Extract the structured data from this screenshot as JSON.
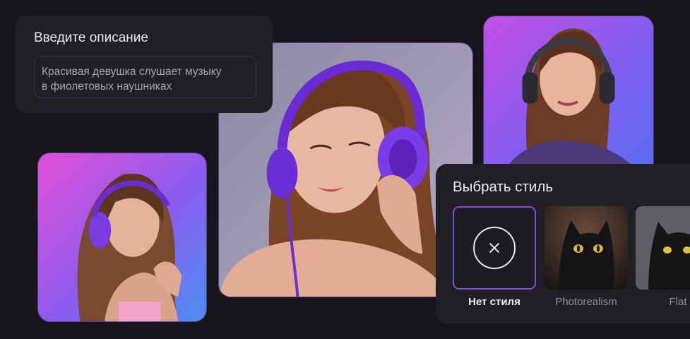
{
  "prompt": {
    "title": "Введите описание",
    "text_line1": "Красивая девушка слушает музыку",
    "text_line2": "в фиолетовых наушниках"
  },
  "style_picker": {
    "title": "Выбрать стиль",
    "options": [
      {
        "label": "Нет стиля",
        "selected": true,
        "icon": "close-icon"
      },
      {
        "label": "Photorealism",
        "selected": false
      },
      {
        "label": "Flat",
        "selected": false
      }
    ]
  },
  "colors": {
    "accent": "#7b4ed1",
    "background": "#16161a",
    "panel": "#1f1f24"
  }
}
